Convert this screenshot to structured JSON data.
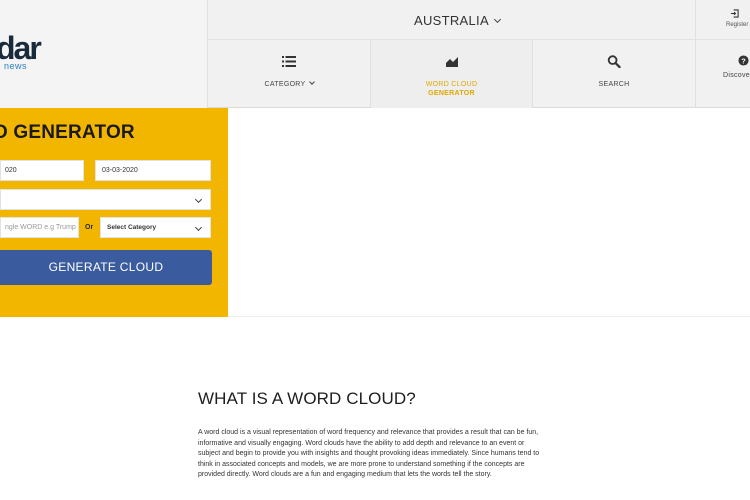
{
  "header": {
    "logo_text": "dar",
    "logo_subtext": "news",
    "country": "AUSTRALIA",
    "register_label": "Register",
    "nav": [
      {
        "label": "CATEGORY",
        "icon": "list-icon"
      },
      {
        "label_line1": "WORD CLOUD",
        "label_line2": "GENERATOR",
        "icon": "chart-icon"
      },
      {
        "label": "SEARCH",
        "icon": "search-icon"
      },
      {
        "label": "Discover",
        "icon": "help-circle-icon"
      }
    ]
  },
  "generator": {
    "title": "D GENERATOR",
    "date_from": "020",
    "date_to": "03-03-2020",
    "select_value": "",
    "word_placeholder": "ngle WORD e.g Trump",
    "or_label": "Or",
    "category_label": "Select Category",
    "button_label": "GENERATE CLOUD"
  },
  "content": {
    "title": "WHAT IS A WORD CLOUD?",
    "body": "A word cloud is a visual representation of word frequency and relevance that provides a result that can be fun, informative and visually engaging. Word clouds have the ability to add depth and relevance to an event or subject and begin to provide you with insights and thought provoking ideas immediately. Since humans tend to think in associated concepts and models, we are more prone to understand something if the concepts are provided directly. Word clouds are a fun and engaging medium that lets the words tell the story."
  },
  "colors": {
    "panel_yellow": "#f2b600",
    "button_blue": "#3a5c9e",
    "active_nav": "#e0a800"
  }
}
